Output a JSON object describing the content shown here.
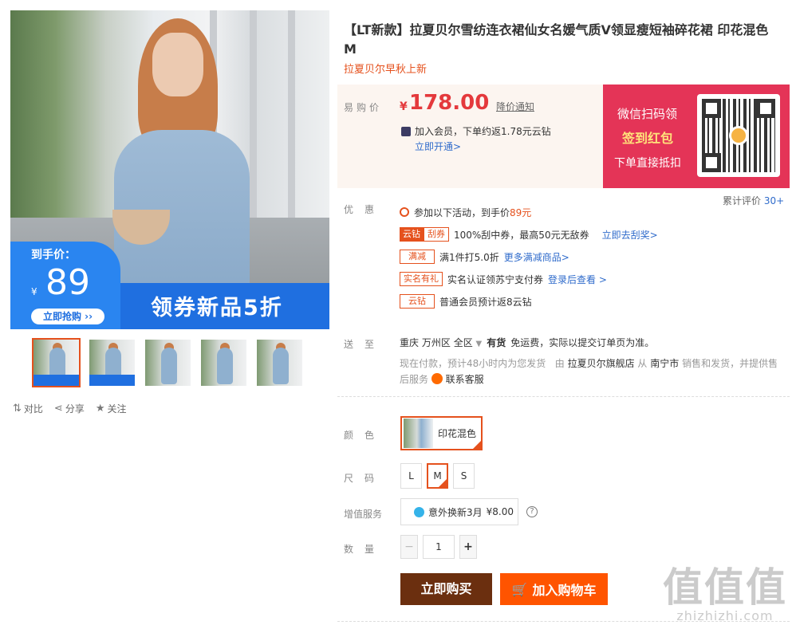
{
  "product": {
    "title": "【LT新款】拉夏贝尔雪纺连衣裙仙女名媛气质V领显瘦短袖碎花裙 印花混色 M",
    "subtitle": "拉夏贝尔早秋上新"
  },
  "gallery": {
    "promo_label": "到手价：",
    "promo_yen": "¥",
    "promo_price": "89",
    "promo_button": "立即抢购 ››",
    "promo_slogan": "领券新品5折",
    "thumbs": [
      "thumb-1",
      "thumb-2",
      "thumb-3",
      "thumb-4",
      "thumb-5"
    ]
  },
  "tools": {
    "compare": "对比",
    "share": "分享",
    "follow": "关注"
  },
  "price": {
    "label": "易购价",
    "yen": "¥",
    "amount": "178.00",
    "notify": "降价通知",
    "vip_text": "加入会员，下单约返1.78元云钻",
    "vip_open": "立即开通>"
  },
  "wechat": {
    "line1": "微信扫码领",
    "line2": "签到红包",
    "line3": "下单直接抵扣"
  },
  "review": {
    "label": "累计评价",
    "value": "30+"
  },
  "promotions": {
    "label": "优惠",
    "head": "参加以下活动，到手价",
    "head_price": "89元",
    "items": [
      {
        "tag_a": "云钻",
        "tag_b": "刮券",
        "text": "100%刮中券，最高50元无敌券",
        "link": "立即去刮奖>"
      },
      {
        "tag": "满减",
        "text": "满1件打5.0折",
        "link": "更多满减商品>"
      },
      {
        "tag": "实名有礼",
        "text": "实名认证领苏宁支付券",
        "link": "登录后查看 >"
      },
      {
        "tag": "云钻",
        "text": "普通会员预计返8云钻"
      }
    ]
  },
  "shipping": {
    "label": "送至",
    "city": "重庆",
    "district": "万州区",
    "area": "全区",
    "stock": "有货",
    "note": "免运费，实际以提交订单页为准。",
    "line2_a": "现在付款，预计48小时内为您发货",
    "line2_b": "由",
    "store": "拉夏贝尔旗舰店",
    "line2_c": "从",
    "from_city": "南宁市",
    "line2_d": "销售和发货，并提供售后服务",
    "service": "联系客服"
  },
  "options": {
    "color_label": "颜色",
    "color_value": "印花混色",
    "size_label": "尺码",
    "sizes": [
      "L",
      "M",
      "S"
    ],
    "service_label": "增值服务",
    "service_value": "意外换新3月",
    "service_price": "¥8.00",
    "qty_label": "数量",
    "qty_value": "1",
    "minus": "−",
    "plus": "+"
  },
  "actions": {
    "buy_now": "立即购买",
    "add_cart": "加入购物车"
  },
  "watermark": {
    "big": "值值值",
    "small": "zhizhizhi.com"
  },
  "colors": {
    "accent": "#e5511d",
    "price_red": "#e4393c",
    "link_blue": "#2f6bcb",
    "buy_brown": "#6b2f0f",
    "cart_orange": "#ff5400",
    "promo_blue": "#1f6fe0"
  }
}
